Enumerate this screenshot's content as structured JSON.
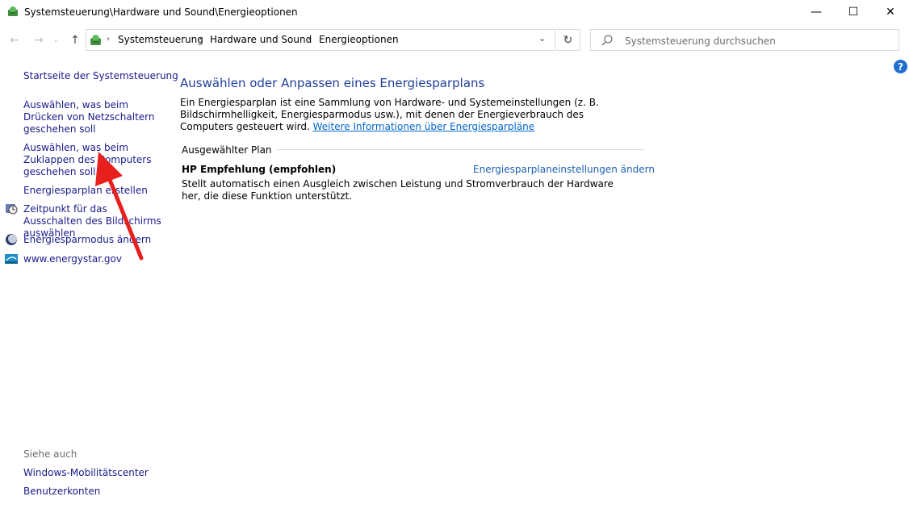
{
  "window": {
    "title": "Systemsteuerung\\Hardware und Sound\\Energieoptionen",
    "minimize_glyph": "—",
    "maximize_glyph": "☐",
    "close_glyph": "✕"
  },
  "nav": {
    "back_glyph": "←",
    "forward_glyph": "→",
    "recent_glyph": "⌄",
    "up_glyph": "↑",
    "refresh_glyph": "↻",
    "dropdown_glyph": "⌄",
    "separator_glyph": "›"
  },
  "address": {
    "crumbs": [
      "Systemsteuerung",
      "Hardware und Sound",
      "Energieoptionen"
    ]
  },
  "search": {
    "placeholder": "Systemsteuerung durchsuchen"
  },
  "help": {
    "glyph": "?"
  },
  "left_pane": {
    "home": "Startseite der Systemsteuerung",
    "power_buttons": "Auswählen, was beim Drücken von Netzschaltern geschehen soll",
    "lid": "Auswählen, was beim Zuklappen des Computers geschehen soll",
    "create_plan": "Energiesparplan erstellen",
    "display_off": "Zeitpunkt für das Ausschalten des Bildschirms auswählen",
    "sleep": "Energiesparmodus ändern",
    "energystar": "www.energystar.gov",
    "see_also": {
      "label": "Siehe auch",
      "mobility": "Windows-Mobilitätscenter",
      "accounts": "Benutzerkonten"
    }
  },
  "main": {
    "heading": "Auswählen oder Anpassen eines Energiesparplans",
    "description": "Ein Energiesparplan ist eine Sammlung von Hardware- und Systemeinstellungen (z. B. Bildschirmhelligkeit, Energiesparmodus usw.), mit denen der Energieverbrauch des Computers gesteuert wird.",
    "more_info_link": "Weitere Informationen über Energiesparpläne",
    "group_label": "Ausgewählter Plan",
    "plan": {
      "name": "HP Empfehlung (empfohlen)",
      "settings_link": "Energiesparplaneinstellungen ändern",
      "description": "Stellt automatisch einen Ausgleich zwischen Leistung und Stromverbrauch der Hardware her, die diese Funktion unterstützt."
    }
  },
  "colors": {
    "link": "#1a1a8c",
    "heading": "#1f3f9a",
    "annotation_arrow": "#e8201d",
    "help_icon": "#1f6fd1"
  }
}
